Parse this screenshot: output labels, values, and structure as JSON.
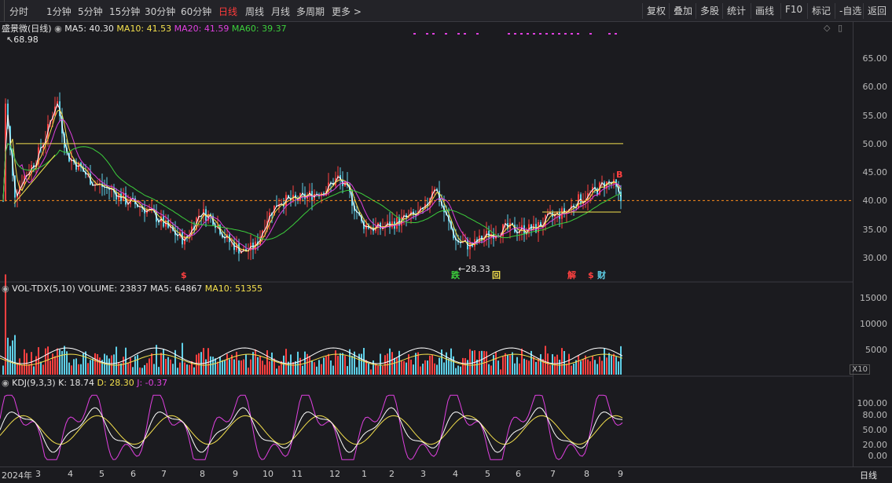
{
  "toolbar": {
    "left_items": [
      "分时",
      "1分钟",
      "5分钟",
      "15分钟",
      "30分钟",
      "60分钟",
      "日线",
      "周线",
      "月线",
      "多周期",
      "更多 >"
    ],
    "active": "日线",
    "right_items": [
      "复权",
      "叠加",
      "多股",
      "统计",
      "画线",
      "F10",
      "标记",
      "-自选",
      "返回"
    ]
  },
  "price_panel": {
    "stock_label": "盛景微(日线)",
    "ma5": "MA5: 40.30",
    "ma10": "MA10: 41.53",
    "ma20": "MA20: 41.59",
    "ma60": "MA60: 39.37",
    "high_marker": "68.98",
    "low_marker": "28.33",
    "y_labels": [
      "65.00",
      "60.00",
      "55.00",
      "50.00",
      "45.00",
      "40.00",
      "35.00",
      "30.00"
    ],
    "event_marks": [
      "$",
      "跌",
      "回",
      "解",
      "$",
      "财",
      "B"
    ]
  },
  "volume_panel": {
    "label": "VOL-TDX(5,10)",
    "volume": "VOLUME: 23837",
    "ma5": "MA5: 64867",
    "ma10": "MA10: 51355",
    "y_labels": [
      "15000",
      "10000",
      "5000"
    ],
    "unit": "X10"
  },
  "kdj_panel": {
    "label": "KDJ(9,3,3)",
    "k": "K: 18.74",
    "d": "D: 28.30",
    "j": "J: -0.37",
    "y_labels": [
      "100.00",
      "80.00",
      "50.00",
      "20.00",
      "0.00"
    ]
  },
  "x_axis": {
    "labels": [
      "2024年",
      "3",
      "4",
      "5",
      "6",
      "7",
      "8",
      "9",
      "10",
      "11",
      "12",
      "1",
      "2",
      "3",
      "4",
      "5",
      "6",
      "7",
      "8",
      "9"
    ],
    "period": "日线"
  },
  "colors": {
    "up": "#ff4040",
    "down": "#5fd0e8",
    "ma5": "#ffffff",
    "ma10": "#f4e04d",
    "ma20": "#e040e0",
    "ma60": "#3ccf3c",
    "support_line": "#ff8c1a",
    "trend_line": "#f4e04d"
  }
}
